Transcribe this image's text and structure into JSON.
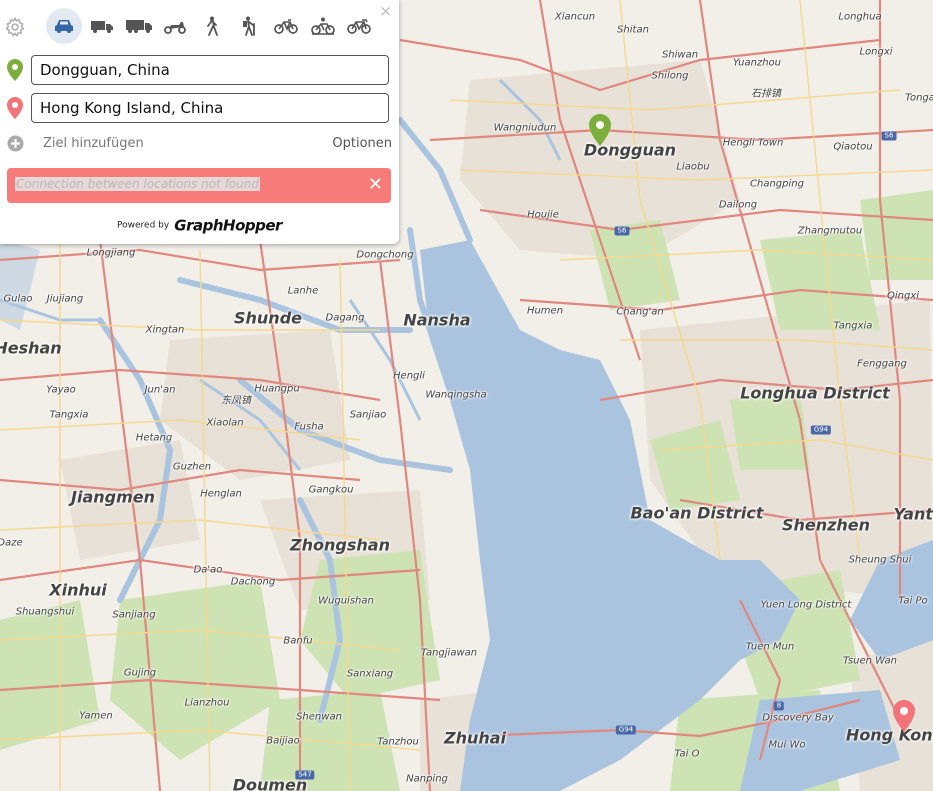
{
  "panel": {
    "close_label": "×",
    "vehicles": [
      {
        "name": "car",
        "active": true
      },
      {
        "name": "small-truck",
        "active": false
      },
      {
        "name": "truck",
        "active": false
      },
      {
        "name": "scooter",
        "active": false
      },
      {
        "name": "foot",
        "active": false
      },
      {
        "name": "hike",
        "active": false
      },
      {
        "name": "bike",
        "active": false
      },
      {
        "name": "mtb",
        "active": false
      },
      {
        "name": "racingbike",
        "active": false
      }
    ],
    "from": {
      "value": "Dongguan, China",
      "marker_color": "#7cae3c"
    },
    "to": {
      "value": "Hong Kong Island, China",
      "marker_color": "#f2737a"
    },
    "add_destination": "Ziel hinzufügen",
    "options": "Optionen",
    "error": {
      "message": "Connection between locations not found",
      "close": "✕",
      "color": "#f77b78"
    },
    "powered_by": "Powered by",
    "brand": "GraphHopper"
  },
  "map": {
    "colors": {
      "land": "#f2efe9",
      "water": "#aac4df",
      "green": "#cde3b4",
      "urban": "#e6dfd6",
      "road_major": "#e0887e",
      "road_minor": "#f6d88c"
    },
    "places": [
      {
        "name": "Dongguan",
        "size": "large"
      },
      {
        "name": "Nansha",
        "size": "large"
      },
      {
        "name": "Shunde",
        "size": "large"
      },
      {
        "name": "Heshan",
        "size": "large"
      },
      {
        "name": "Jiangmen",
        "size": "large"
      },
      {
        "name": "Zhongshan",
        "size": "large"
      },
      {
        "name": "Xinhui",
        "size": "large"
      },
      {
        "name": "Zhuhai",
        "size": "large"
      },
      {
        "name": "Doumen",
        "size": "large"
      },
      {
        "name": "Longhua District",
        "size": "large"
      },
      {
        "name": "Bao'an District",
        "size": "large"
      },
      {
        "name": "Shenzhen",
        "size": "large"
      },
      {
        "name": "Hong Kong",
        "size": "large"
      },
      {
        "name": "Yanti",
        "size": "large"
      },
      {
        "name": "Xiancun",
        "size": "small"
      },
      {
        "name": "Shitan",
        "size": "small"
      },
      {
        "name": "Longhua",
        "size": "small"
      },
      {
        "name": "Shiwan",
        "size": "small"
      },
      {
        "name": "Longxi",
        "size": "small"
      },
      {
        "name": "Yuanzhou",
        "size": "small"
      },
      {
        "name": "Shilong",
        "size": "small"
      },
      {
        "name": "石排镇",
        "size": "small"
      },
      {
        "name": "Tonga",
        "size": "small"
      },
      {
        "name": "Wangniudun",
        "size": "small"
      },
      {
        "name": "Hengli Town",
        "size": "small"
      },
      {
        "name": "Qiaotou",
        "size": "small"
      },
      {
        "name": "Liaobu",
        "size": "small"
      },
      {
        "name": "Changping",
        "size": "small"
      },
      {
        "name": "Dailong",
        "size": "small"
      },
      {
        "name": "Houjie",
        "size": "small"
      },
      {
        "name": "Zhangmutou",
        "size": "small"
      },
      {
        "name": "Longjiang",
        "size": "small"
      },
      {
        "name": "Dongchong",
        "size": "small"
      },
      {
        "name": "Lanhe",
        "size": "small"
      },
      {
        "name": "Gulao",
        "size": "small"
      },
      {
        "name": "Jiujiang",
        "size": "small"
      },
      {
        "name": "Dagang",
        "size": "small"
      },
      {
        "name": "Humen",
        "size": "small"
      },
      {
        "name": "Qingxi",
        "size": "small"
      },
      {
        "name": "Xingtan",
        "size": "small"
      },
      {
        "name": "Chang'an",
        "size": "small"
      },
      {
        "name": "Tangxia",
        "size": "small"
      },
      {
        "name": "Fenggang",
        "size": "small"
      },
      {
        "name": "Hengli",
        "size": "small"
      },
      {
        "name": "Yayao",
        "size": "small"
      },
      {
        "name": "Jun'an",
        "size": "small"
      },
      {
        "name": "Huangpu",
        "size": "small"
      },
      {
        "name": "Wanqingsha",
        "size": "small"
      },
      {
        "name": "东凤镇",
        "size": "small"
      },
      {
        "name": "Tangxia",
        "size": "small"
      },
      {
        "name": "Sanjiao",
        "size": "small"
      },
      {
        "name": "Xiaolan",
        "size": "small"
      },
      {
        "name": "Hetang",
        "size": "small"
      },
      {
        "name": "Fusha",
        "size": "small"
      },
      {
        "name": "Guzhen",
        "size": "small"
      },
      {
        "name": "Henglan",
        "size": "small"
      },
      {
        "name": "Gangkou",
        "size": "small"
      },
      {
        "name": "Daze",
        "size": "small"
      },
      {
        "name": "Da'ao",
        "size": "small"
      },
      {
        "name": "Dachong",
        "size": "small"
      },
      {
        "name": "Shuangshui",
        "size": "small"
      },
      {
        "name": "Sanjiang",
        "size": "small"
      },
      {
        "name": "Wuguishan",
        "size": "small"
      },
      {
        "name": "Banfu",
        "size": "small"
      },
      {
        "name": "Tanzhou",
        "size": "small"
      },
      {
        "name": "Sanxiang",
        "size": "small"
      },
      {
        "name": "Tangjiawan",
        "size": "small"
      },
      {
        "name": "Gujing",
        "size": "small"
      },
      {
        "name": "Lianzhou",
        "size": "small"
      },
      {
        "name": "Yamen",
        "size": "small"
      },
      {
        "name": "Shenwan",
        "size": "small"
      },
      {
        "name": "Baijiao",
        "size": "small"
      },
      {
        "name": "Nanping",
        "size": "small"
      },
      {
        "name": "Sheung Shui",
        "size": "small"
      },
      {
        "name": "Tai Po",
        "size": "small"
      },
      {
        "name": "Yuen Long District",
        "size": "small"
      },
      {
        "name": "Tuen Mun",
        "size": "small"
      },
      {
        "name": "Tsuen Wan",
        "size": "small"
      },
      {
        "name": "Discovery Bay",
        "size": "small"
      },
      {
        "name": "Mui Wo",
        "size": "small"
      },
      {
        "name": "Tai O",
        "size": "small"
      }
    ],
    "shields": [
      "S6",
      "S6",
      "G94",
      "G94",
      "S47",
      "8"
    ]
  }
}
